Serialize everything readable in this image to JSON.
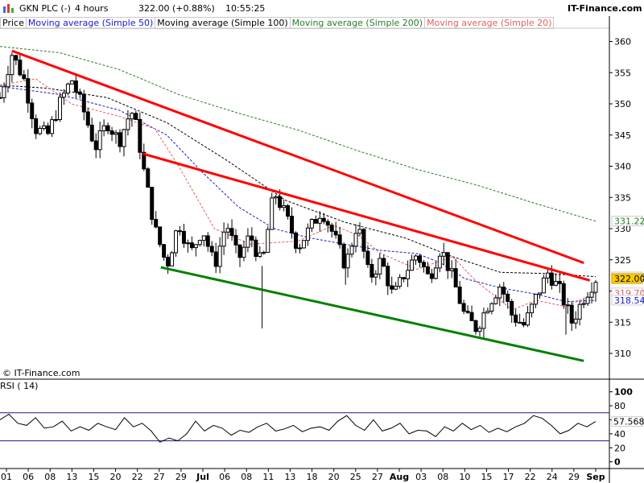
{
  "header": {
    "symbol": "GKN PLC (-)",
    "interval": "4 hours",
    "quote": "322.00 (+0.88%)",
    "time": "10:55:25",
    "brand": "IT-Finance.com",
    "logo_icon": "chart-icon"
  },
  "legend": {
    "items": [
      {
        "label": "Price",
        "color": "#000000"
      },
      {
        "label": "Moving average (Simple 50)",
        "color": "#1a1acc"
      },
      {
        "label": "Moving average (Simple 100)",
        "color": "#000000"
      },
      {
        "label": "Moving average (Simple 200)",
        "color": "#2a7a2a"
      },
      {
        "label": "Moving average (Simple 20)",
        "color": "#e06060"
      }
    ]
  },
  "credit": "© IT-Finance.com",
  "chart_data": [
    {
      "type": "candlestick",
      "title": "GKN PLC (-)",
      "y_ticks": [
        310,
        315,
        320,
        325,
        330,
        335,
        340,
        345,
        350,
        355,
        360
      ],
      "ylim": [
        306,
        362
      ],
      "x_tick_labels": [
        "01",
        "06",
        "08",
        "13",
        "15",
        "20",
        "22",
        "27",
        "29",
        "Jul",
        "06",
        "08",
        "11",
        "13",
        "18",
        "20",
        "25",
        "27",
        "Aug",
        "03",
        "08",
        "10",
        "15",
        "17",
        "22",
        "24",
        "29",
        "Sep"
      ],
      "grid": false,
      "last_price": 322.0,
      "value_tags": [
        {
          "name": "Moving average (Simple 200)",
          "value": 331.22,
          "color": "#2a7a2a"
        },
        {
          "name": "Moving average (Simple 100)",
          "value": 322.26,
          "color": "#000000"
        },
        {
          "name": "Price",
          "value": 322.0,
          "color": "#ffcc00"
        },
        {
          "name": "Moving average (Simple 20)",
          "value": 319.7,
          "color": "#e06060"
        },
        {
          "name": "Moving average (Simple 50)",
          "value": 318.54,
          "color": "#1a1acc"
        }
      ],
      "trendlines": [
        {
          "color": "#ff0000",
          "from": [
            0.02,
            358.5
          ],
          "to": [
            0.98,
            324.5
          ]
        },
        {
          "color": "#ff0000",
          "from": [
            0.24,
            342.0
          ],
          "to": [
            0.99,
            321.7
          ]
        },
        {
          "color": "#008000",
          "from": [
            0.27,
            323.8
          ],
          "to": [
            0.98,
            308.8
          ]
        }
      ],
      "ma200": [
        [
          0.0,
          359.2
        ],
        [
          0.1,
          358.2
        ],
        [
          0.2,
          355.5
        ],
        [
          0.3,
          351.5
        ],
        [
          0.4,
          348.5
        ],
        [
          0.5,
          345.8
        ],
        [
          0.6,
          342.5
        ],
        [
          0.7,
          339.5
        ],
        [
          0.8,
          337.0
        ],
        [
          0.9,
          334.0
        ],
        [
          1.0,
          331.2
        ]
      ],
      "ma100": [
        [
          0.0,
          353.0
        ],
        [
          0.08,
          352.5
        ],
        [
          0.18,
          351.0
        ],
        [
          0.28,
          347.0
        ],
        [
          0.38,
          341.0
        ],
        [
          0.48,
          334.5
        ],
        [
          0.58,
          331.0
        ],
        [
          0.68,
          328.5
        ],
        [
          0.76,
          325.5
        ],
        [
          0.84,
          323.0
        ],
        [
          0.92,
          322.8
        ],
        [
          1.0,
          322.3
        ]
      ],
      "ma50": [
        [
          0.0,
          352.8
        ],
        [
          0.1,
          351.5
        ],
        [
          0.2,
          349.0
        ],
        [
          0.28,
          345.0
        ],
        [
          0.34,
          339.0
        ],
        [
          0.4,
          333.5
        ],
        [
          0.46,
          330.0
        ],
        [
          0.52,
          328.5
        ],
        [
          0.58,
          327.5
        ],
        [
          0.64,
          326.5
        ],
        [
          0.7,
          326.0
        ],
        [
          0.74,
          324.5
        ],
        [
          0.78,
          322.0
        ],
        [
          0.84,
          320.5
        ],
        [
          0.9,
          319.5
        ],
        [
          0.95,
          318.3
        ],
        [
          1.0,
          318.5
        ]
      ],
      "ma20": [
        [
          0.0,
          353.0
        ],
        [
          0.06,
          354.0
        ],
        [
          0.12,
          350.0
        ],
        [
          0.2,
          348.0
        ],
        [
          0.26,
          346.0
        ],
        [
          0.3,
          340.0
        ],
        [
          0.36,
          330.0
        ],
        [
          0.42,
          327.5
        ],
        [
          0.5,
          328.0
        ],
        [
          0.56,
          330.5
        ],
        [
          0.6,
          329.0
        ],
        [
          0.64,
          326.0
        ],
        [
          0.7,
          323.5
        ],
        [
          0.76,
          325.5
        ],
        [
          0.8,
          321.5
        ],
        [
          0.86,
          317.0
        ],
        [
          0.9,
          318.5
        ],
        [
          0.95,
          317.5
        ],
        [
          1.0,
          319.7
        ]
      ],
      "price_path": [
        [
          0.0,
          351.0
        ],
        [
          0.02,
          358.0
        ],
        [
          0.04,
          354.0
        ],
        [
          0.06,
          346.0
        ],
        [
          0.08,
          345.0
        ],
        [
          0.1,
          350.0
        ],
        [
          0.12,
          354.0
        ],
        [
          0.14,
          349.0
        ],
        [
          0.16,
          343.0
        ],
        [
          0.18,
          347.0
        ],
        [
          0.2,
          344.0
        ],
        [
          0.22,
          349.0
        ],
        [
          0.23,
          346.0
        ],
        [
          0.24,
          340.0
        ],
        [
          0.26,
          330.0
        ],
        [
          0.28,
          324.0
        ],
        [
          0.3,
          331.0
        ],
        [
          0.32,
          326.0
        ],
        [
          0.34,
          330.0
        ],
        [
          0.36,
          324.0
        ],
        [
          0.38,
          331.0
        ],
        [
          0.4,
          325.0
        ],
        [
          0.42,
          329.0
        ],
        [
          0.44,
          324.0
        ],
        [
          0.46,
          336.0
        ],
        [
          0.48,
          332.0
        ],
        [
          0.5,
          327.0
        ],
        [
          0.52,
          330.0
        ],
        [
          0.54,
          333.0
        ],
        [
          0.56,
          329.0
        ],
        [
          0.58,
          324.0
        ],
        [
          0.6,
          331.0
        ],
        [
          0.62,
          322.0
        ],
        [
          0.64,
          325.0
        ],
        [
          0.66,
          319.0
        ],
        [
          0.68,
          323.0
        ],
        [
          0.7,
          326.0
        ],
        [
          0.72,
          322.0
        ],
        [
          0.74,
          327.0
        ],
        [
          0.76,
          322.0
        ],
        [
          0.78,
          316.0
        ],
        [
          0.8,
          314.0
        ],
        [
          0.82,
          318.0
        ],
        [
          0.84,
          321.0
        ],
        [
          0.86,
          316.0
        ],
        [
          0.88,
          314.5
        ],
        [
          0.9,
          319.0
        ],
        [
          0.92,
          323.0
        ],
        [
          0.94,
          320.0
        ],
        [
          0.96,
          315.0
        ],
        [
          0.98,
          319.0
        ],
        [
          1.0,
          322.0
        ]
      ],
      "price_spikes": [
        [
          0.44,
          314.0
        ],
        [
          0.58,
          321.0
        ],
        [
          0.95,
          313.0
        ]
      ]
    },
    {
      "type": "line",
      "title": "RSI ( 14)",
      "y_ticks": [
        0,
        20,
        40,
        60,
        80,
        100
      ],
      "ylim": [
        -5,
        110
      ],
      "reference_lines": [
        30,
        70
      ],
      "last_value": 57.568,
      "values": [
        60,
        68,
        55,
        52,
        63,
        48,
        50,
        58,
        44,
        50,
        45,
        55,
        50,
        46,
        63,
        50,
        55,
        44,
        28,
        34,
        30,
        40,
        58,
        44,
        52,
        48,
        38,
        45,
        42,
        50,
        55,
        44,
        47,
        52,
        43,
        48,
        50,
        45,
        58,
        66,
        52,
        45,
        60,
        44,
        48,
        55,
        40,
        45,
        44,
        36,
        50,
        44,
        55,
        46,
        52,
        42,
        48,
        43,
        50,
        55,
        66,
        62,
        52,
        40,
        45,
        55,
        50,
        57.568
      ]
    }
  ]
}
